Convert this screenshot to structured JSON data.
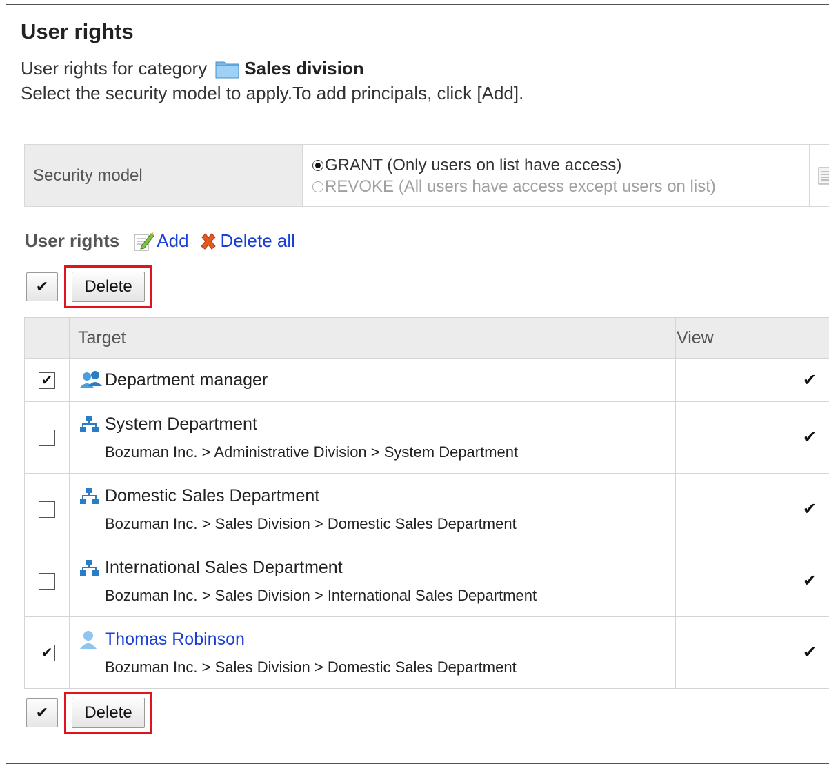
{
  "page": {
    "title": "User rights",
    "category_prefix": "User rights for category",
    "category_name": "Sales division",
    "instructions": "Select the security model to apply.To add principals, click [Add]."
  },
  "security": {
    "label": "Security model",
    "options": [
      {
        "label": "GRANT (Only users on list have access)",
        "selected": true,
        "disabled": false
      },
      {
        "label": "REVOKE (All users have access except users on list)",
        "selected": false,
        "disabled": true
      }
    ]
  },
  "user_rights": {
    "label": "User rights",
    "add_label": "Add",
    "delete_all_label": "Delete all"
  },
  "toolbar": {
    "toggle_glyph": "✔",
    "delete_label": "Delete"
  },
  "table": {
    "columns": {
      "target": "Target",
      "view": "View"
    },
    "rows": [
      {
        "type": "role",
        "name": "Department manager",
        "path": "",
        "checked": true,
        "view": "✔",
        "link": false
      },
      {
        "type": "org",
        "name": "System Department",
        "path": "Bozuman Inc. > Administrative Division > System Department",
        "checked": false,
        "view": "✔",
        "link": false
      },
      {
        "type": "org",
        "name": "Domestic Sales Department",
        "path": "Bozuman Inc. > Sales Division > Domestic Sales Department",
        "checked": false,
        "view": "✔",
        "link": false
      },
      {
        "type": "org",
        "name": "International Sales Department",
        "path": "Bozuman Inc. > Sales Division > International Sales Department",
        "checked": false,
        "view": "✔",
        "link": false
      },
      {
        "type": "user",
        "name": "Thomas Robinson",
        "path": "Bozuman Inc. > Sales Division > Domestic Sales Department",
        "checked": true,
        "view": "✔",
        "link": true
      }
    ]
  },
  "colors": {
    "link": "#1a3fd6",
    "highlight": "#e0141e",
    "header_bg": "#ececec"
  }
}
